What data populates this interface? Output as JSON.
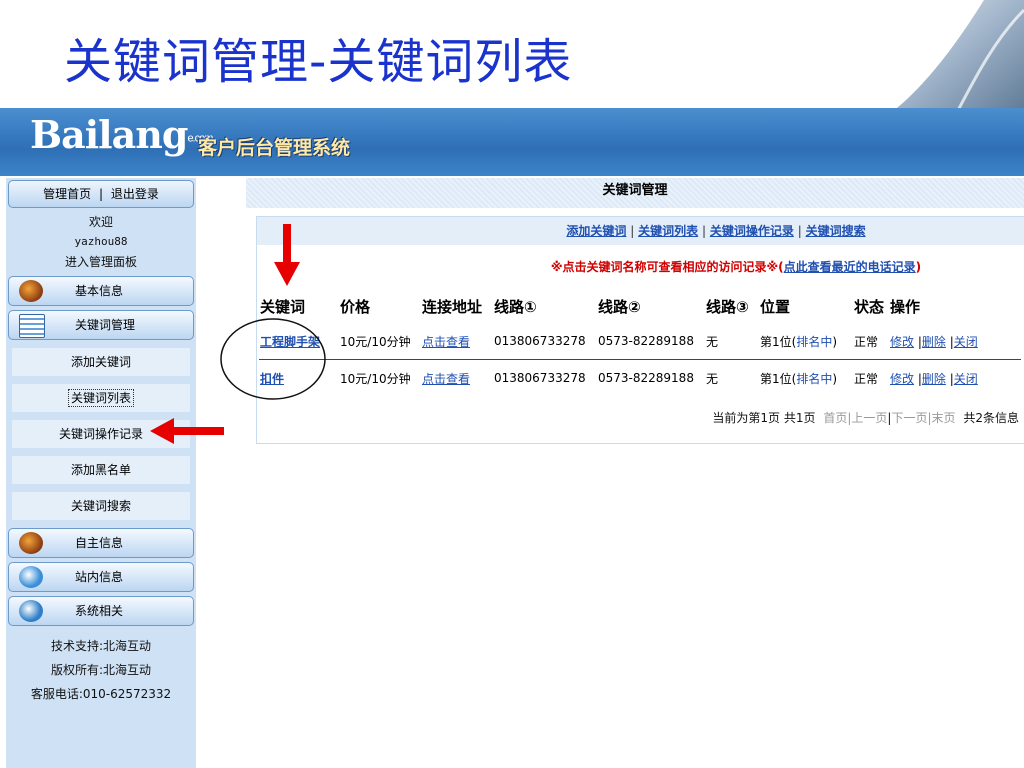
{
  "slide_title": "关键词管理-关键词列表",
  "header": {
    "logo_main": "Bailang",
    "logo_suffix": "e.com",
    "app_name": "客户后台管理系统"
  },
  "sidebar": {
    "top_home": "管理首页",
    "top_sep": "|",
    "top_logout": "退出登录",
    "welcome": "欢迎",
    "username": "yazhou88",
    "enter_panel": "进入管理面板",
    "sections": {
      "basic_info": "基本信息",
      "keyword_mgmt": "关键词管理",
      "self_info": "自主信息",
      "site_info": "站内信息",
      "system": "系统相关"
    },
    "sub_items": {
      "add_keyword": "添加关键词",
      "keyword_list": "关键词列表",
      "keyword_log": "关键词操作记录",
      "add_blacklist": "添加黑名单",
      "keyword_search": "关键词搜索"
    },
    "footer": {
      "support": "技术支持:北海互动",
      "copyright": "版权所有:北海互动",
      "phone": "客服电话:010-62572332"
    }
  },
  "content": {
    "header_title": "关键词管理",
    "links": [
      "添加关键词",
      "关键词列表",
      "关键词操作记录",
      "关键词搜索"
    ],
    "link_sep": "|",
    "notice_prefix": "※点击关键词名称可查看相应的访问记录※(",
    "notice_link": "点此查看最近的电话记录",
    "notice_suffix": ")",
    "columns": [
      "关键词",
      "价格",
      "连接地址",
      "线路①",
      "线路②",
      "线路③",
      "位置",
      "状态",
      "操作"
    ],
    "rows": [
      {
        "keyword": "工程脚手架",
        "price": "10元/10分钟",
        "url": "点击查看",
        "line1": "013806733278",
        "line2": "0573-82289188",
        "line3": "无",
        "pos_prefix": "第1位(",
        "pos_rank": "排名中",
        "pos_suffix": ")",
        "status": "正常",
        "op_edit": "修改",
        "op_delete": "删除",
        "op_close": "关闭"
      },
      {
        "keyword": "扣件",
        "price": "10元/10分钟",
        "url": "点击查看",
        "line1": "013806733278",
        "line2": "0573-82289188",
        "line3": "无",
        "pos_prefix": "第1位(",
        "pos_rank": "排名中",
        "pos_suffix": ")",
        "status": "正常",
        "op_edit": "修改",
        "op_delete": "删除",
        "op_close": "关闭"
      }
    ],
    "pager": {
      "current": "当前为第1页 共1页",
      "first": "首页",
      "prev": "上一页",
      "next": "下一页",
      "last": "末页",
      "total": "共2条信息",
      "sep": "|"
    }
  },
  "colors": {
    "title_blue": "#1a33cc",
    "link_blue": "#2050b0",
    "notice_red": "#d10000",
    "annotation_red": "#e60000"
  }
}
